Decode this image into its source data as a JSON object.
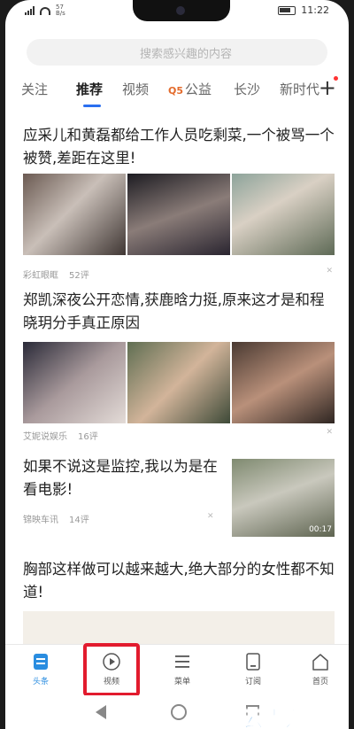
{
  "status": {
    "speed_value": "57",
    "speed_unit": "B/s",
    "time": "11:22"
  },
  "search": {
    "placeholder": "搜索感兴趣的内容"
  },
  "tabs": [
    {
      "label": "关注"
    },
    {
      "label": "推荐"
    },
    {
      "label": "视频"
    },
    {
      "label": "公益"
    },
    {
      "label": "长沙"
    },
    {
      "label": "新时代"
    }
  ],
  "articles": [
    {
      "title": "应采儿和黄磊都给工作人员吃剩菜,一个被骂一个被赞,差距在这里!",
      "source": "彩虹眼眶",
      "comments": "52评"
    },
    {
      "title": "郑凯深夜公开恋情,获鹿晗力挺,原来这才是和程晓玥分手真正原因",
      "source": "艾妮说娱乐",
      "comments": "16评"
    },
    {
      "title": "如果不说这是监控,我以为是在看电影!",
      "source": "锦映车讯",
      "comments": "14评",
      "duration": "00:17"
    },
    {
      "title": "胸部这样做可以越来越大,绝大部分的女性都不知道!"
    }
  ],
  "bottom_tabs": [
    {
      "label": "头条"
    },
    {
      "label": "视频"
    },
    {
      "label": "菜单"
    },
    {
      "label": "订阅"
    },
    {
      "label": "首页"
    }
  ],
  "watermark": "云南龙网",
  "colors": {
    "accent": "#2a6ff0",
    "highlight": "#e21b2e",
    "active_tab": "#2a8de0"
  }
}
